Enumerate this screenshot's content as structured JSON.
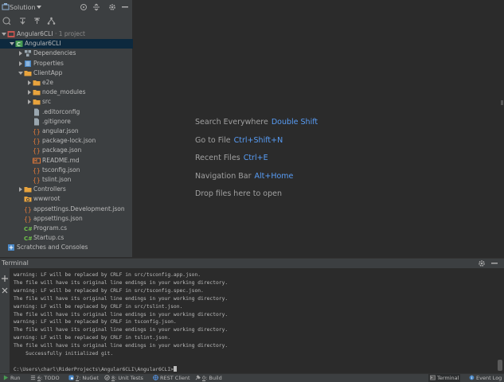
{
  "solution_panel": {
    "title": "Solution",
    "tree": [
      {
        "label": "Angular6CLI",
        "suffix": " · 1 project",
        "icon": "solution-icon",
        "depth": 0,
        "arrow": "down"
      },
      {
        "label": "Angular6CLI",
        "icon": "project-icon",
        "depth": 1,
        "arrow": "down",
        "selected": true
      },
      {
        "label": "Dependencies",
        "icon": "dependencies-icon",
        "depth": 2,
        "arrow": "right"
      },
      {
        "label": "Properties",
        "icon": "properties-icon",
        "depth": 2,
        "arrow": "right"
      },
      {
        "label": "ClientApp",
        "icon": "folder-icon",
        "depth": 2,
        "arrow": "down"
      },
      {
        "label": "e2e",
        "icon": "folder-icon",
        "depth": 3,
        "arrow": "right"
      },
      {
        "label": "node_modules",
        "icon": "folder-icon",
        "depth": 3,
        "arrow": "right"
      },
      {
        "label": "src",
        "icon": "folder-icon",
        "depth": 3,
        "arrow": "right"
      },
      {
        "label": ".editorconfig",
        "icon": "file-icon",
        "depth": 3
      },
      {
        "label": ".gitignore",
        "icon": "file-icon",
        "depth": 3
      },
      {
        "label": "angular.json",
        "icon": "json-icon",
        "depth": 3
      },
      {
        "label": "package-lock.json",
        "icon": "json-icon",
        "depth": 3
      },
      {
        "label": "package.json",
        "icon": "json-icon",
        "depth": 3
      },
      {
        "label": "README.md",
        "icon": "markdown-icon",
        "depth": 3
      },
      {
        "label": "tsconfig.json",
        "icon": "json-icon",
        "depth": 3
      },
      {
        "label": "tslint.json",
        "icon": "json-icon",
        "depth": 3
      },
      {
        "label": "Controllers",
        "icon": "folder-icon",
        "depth": 2,
        "arrow": "right"
      },
      {
        "label": "wwwroot",
        "icon": "web-folder-icon",
        "depth": 2
      },
      {
        "label": "appsettings.Development.json",
        "icon": "json-icon",
        "depth": 2
      },
      {
        "label": "appsettings.json",
        "icon": "json-icon",
        "depth": 2
      },
      {
        "label": "Program.cs",
        "icon": "csharp-icon",
        "depth": 2
      },
      {
        "label": "Startup.cs",
        "icon": "csharp-icon",
        "depth": 2
      },
      {
        "label": "Scratches and Consoles",
        "icon": "scratches-icon",
        "depth": 0
      }
    ]
  },
  "editor_hints": [
    {
      "text": "Search Everywhere",
      "key": "Double Shift"
    },
    {
      "text": "Go to File",
      "key": "Ctrl+Shift+N"
    },
    {
      "text": "Recent Files",
      "key": "Ctrl+E"
    },
    {
      "text": "Navigation Bar",
      "key": "Alt+Home"
    },
    {
      "text": "Drop files here to open",
      "key": ""
    }
  ],
  "terminal": {
    "title": "Terminal",
    "lines": [
      "warning: LF will be replaced by CRLF in src/tsconfig.app.json.",
      "The file will have its original line endings in your working directory.",
      "warning: LF will be replaced by CRLF in src/tsconfig.spec.json.",
      "The file will have its original line endings in your working directory.",
      "warning: LF will be replaced by CRLF in src/tslint.json.",
      "The file will have its original line endings in your working directory.",
      "warning: LF will be replaced by CRLF in tsconfig.json.",
      "The file will have its original line endings in your working directory.",
      "warning: LF will be replaced by CRLF in tslint.json.",
      "The file will have its original line endings in your working directory.",
      "    Successfully initialized git."
    ],
    "prompt": "C:\\Users\\charl\\RiderProjects\\Angular6CLI\\Angular6CLI>"
  },
  "bottom_tabs": [
    {
      "num": "",
      "label": "Run",
      "icon": "run-icon"
    },
    {
      "num": "6",
      "label": "TODO",
      "icon": "todo-icon"
    },
    {
      "num": "7",
      "label": "NuGet",
      "icon": "nuget-icon"
    },
    {
      "num": "8",
      "label": "Unit Tests",
      "icon": "unit-tests-icon"
    },
    {
      "num": "",
      "label": "REST Client",
      "icon": "rest-client-icon"
    },
    {
      "num": "0",
      "label": "Build",
      "icon": "build-icon"
    }
  ],
  "bottom_right_tabs": [
    {
      "label": "Terminal",
      "icon": "terminal-icon",
      "active": true
    },
    {
      "label": "Event Log",
      "icon": "event-log-icon"
    }
  ],
  "colors": {
    "panel_bg": "#3c3f41",
    "editor_bg": "#2b2b2b",
    "selection": "#0d293e",
    "key_blue": "#589df6",
    "folder": "#e8a33d",
    "json": "#e0793a",
    "csharp": "#6fbf4a"
  }
}
